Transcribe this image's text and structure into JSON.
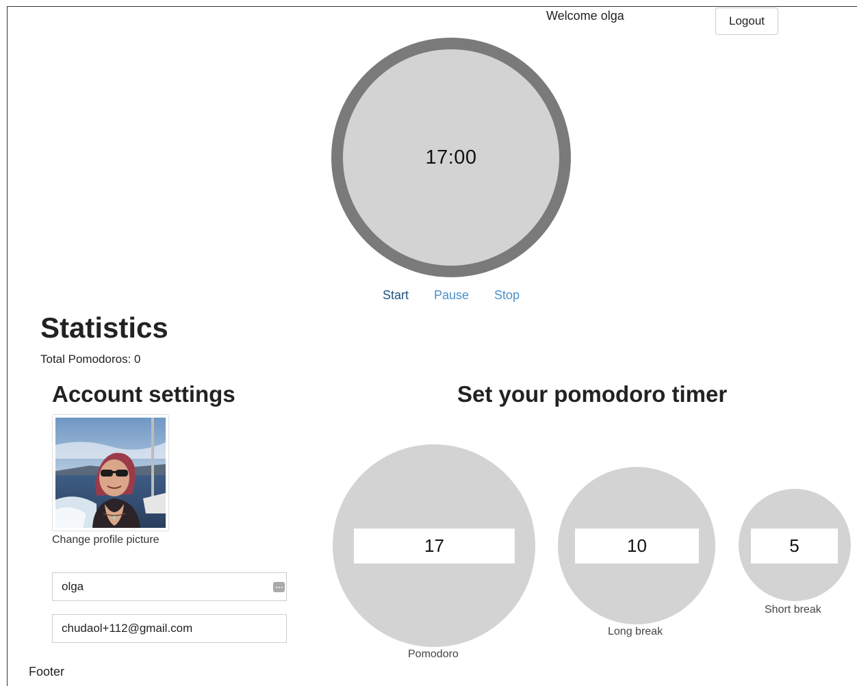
{
  "header": {
    "welcome_text": "Welcome olga",
    "logout_label": "Logout"
  },
  "timer": {
    "display": "17:00",
    "controls": {
      "start": "Start",
      "pause": "Pause",
      "stop": "Stop"
    }
  },
  "statistics": {
    "title": "Statistics",
    "total_label": "Total Pomodoros: 0"
  },
  "account": {
    "title": "Account settings",
    "change_picture_label": "Change profile picture",
    "username_value": "olga",
    "email_value": "chudaol+112@gmail.com"
  },
  "timer_settings": {
    "title": "Set your pomodoro timer",
    "pomodoro": {
      "value": "17",
      "label": "Pomodoro"
    },
    "long_break": {
      "value": "10",
      "label": "Long break"
    },
    "short_break": {
      "value": "5",
      "label": "Short break"
    }
  },
  "footer": {
    "text": "Footer"
  },
  "colors": {
    "ring": "#7a7a7a",
    "face": "#d3d3d3",
    "link_active": "#23527c",
    "link": "#4a90c8"
  }
}
